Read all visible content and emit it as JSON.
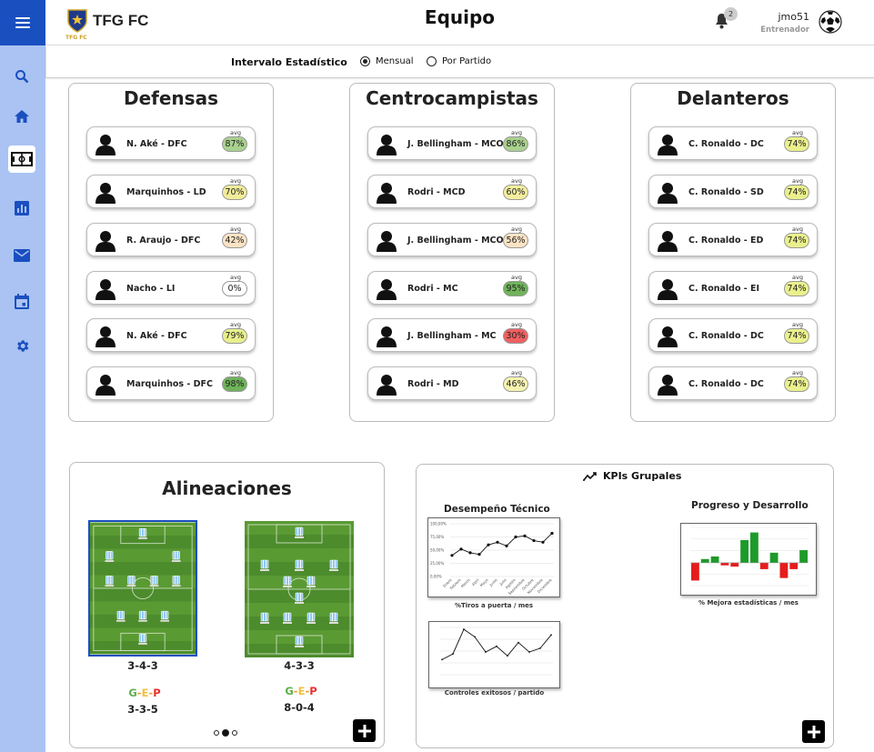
{
  "app": {
    "brand": "TFG FC",
    "brand_sub": "TFG FC",
    "page_title": "Equipo",
    "notifications_count": "2",
    "user_name": "jmo51",
    "user_role": "Entrenador"
  },
  "sidebar": {
    "items": [
      {
        "icon": "search-icon"
      },
      {
        "icon": "home-icon"
      },
      {
        "icon": "field-icon",
        "active": true
      },
      {
        "icon": "bar-chart-icon"
      },
      {
        "icon": "mail-icon"
      },
      {
        "icon": "calendar-icon"
      },
      {
        "icon": "gear-icon"
      }
    ]
  },
  "interval": {
    "label": "Intervalo Estadístico",
    "options": [
      {
        "label": "Mensual",
        "selected": true
      },
      {
        "label": "Por Partido",
        "selected": false
      }
    ]
  },
  "avg_label": "avg",
  "groups": [
    {
      "title": "Defensas",
      "players": [
        {
          "name": "N. Aké - DFC",
          "value": "87%",
          "color": "#a9d18e"
        },
        {
          "name": "Marquinhos - LD",
          "value": "70%",
          "color": "#f1ec9a"
        },
        {
          "name": "R. Araujo - DFC",
          "value": "42%",
          "color": "#fbe3c4"
        },
        {
          "name": "Nacho - LI",
          "value": "0%",
          "color": "#ffffff"
        },
        {
          "name": "N. Aké - DFC",
          "value": "79%",
          "color": "#e8ef8c"
        },
        {
          "name": "Marquinhos - DFC",
          "value": "98%",
          "color": "#6fb35a"
        }
      ]
    },
    {
      "title": "Centrocampistas",
      "players": [
        {
          "name": "J. Bellingham - MCO",
          "value": "86%",
          "color": "#a9d18e"
        },
        {
          "name": "Rodri - MCD",
          "value": "60%",
          "color": "#f4ee9e"
        },
        {
          "name": "J. Bellingham - MCO",
          "value": "56%",
          "color": "#fbe3c4"
        },
        {
          "name": "Rodri - MC",
          "value": "95%",
          "color": "#6fb35a"
        },
        {
          "name": "J. Bellingham - MC",
          "value": "30%",
          "color": "#f06060"
        },
        {
          "name": "Rodri - MD",
          "value": "46%",
          "color": "#f6f3b0"
        }
      ]
    },
    {
      "title": "Delanteros",
      "players": [
        {
          "name": "C. Ronaldo - DC",
          "value": "74%",
          "color": "#eaf08c"
        },
        {
          "name": "C. Ronaldo - SD",
          "value": "74%",
          "color": "#eaf08c"
        },
        {
          "name": "C. Ronaldo - ED",
          "value": "74%",
          "color": "#eaf08c"
        },
        {
          "name": "C. Ronaldo - EI",
          "value": "74%",
          "color": "#eaf08c"
        },
        {
          "name": "C. Ronaldo - DC",
          "value": "74%",
          "color": "#eaf08c"
        },
        {
          "name": "C. Ronaldo - DC",
          "value": "74%",
          "color": "#eaf08c"
        }
      ]
    }
  ],
  "lineups": {
    "title": "Alineaciones",
    "gep_g": "G",
    "gep_e": "E",
    "gep_p": "P",
    "gep_sep": "-",
    "items": [
      {
        "formation": "3-4-3",
        "record": "3-3-5"
      },
      {
        "formation": "4-3-3",
        "record": "8-0-4"
      }
    ]
  },
  "kpis": {
    "title": "KPIs Grupales",
    "technical_title": "Desempeño Técnico",
    "progress_title": "Progreso y Desarrollo",
    "captions": {
      "shots": "%Tiros a puerta / mes",
      "controls": "Controles exitosos / partido",
      "improvement": "% Mejora estadísticas / mes"
    }
  },
  "chart_data": [
    {
      "type": "line",
      "caption": "%Tiros a puerta / mes",
      "x": [
        "Enero",
        "Febrero",
        "Marzo",
        "Abril",
        "Mayo",
        "Junio",
        "Julio",
        "Agosto",
        "Septiembre",
        "Octubre",
        "Noviembre",
        "Diciembre"
      ],
      "yticks": [
        "100,00%",
        "75,00%",
        "50,00%",
        "25,00%",
        "0,00%"
      ],
      "values": [
        40,
        52,
        45,
        42,
        60,
        65,
        58,
        75,
        77,
        68,
        65,
        82
      ],
      "ylim": [
        0,
        100
      ]
    },
    {
      "type": "line",
      "caption": "Controles exitosos / partido",
      "values": [
        18,
        21,
        34,
        30,
        22,
        25,
        20,
        27,
        22,
        24,
        31
      ],
      "ylim": [
        10,
        35
      ]
    },
    {
      "type": "bar",
      "caption": "% Mejora estadísticas / mes",
      "values": [
        -7,
        1.5,
        2.5,
        -1,
        -1.5,
        9,
        12,
        -2.5,
        4,
        -6,
        -2.5,
        5
      ],
      "ylim": [
        -9,
        14
      ]
    }
  ]
}
